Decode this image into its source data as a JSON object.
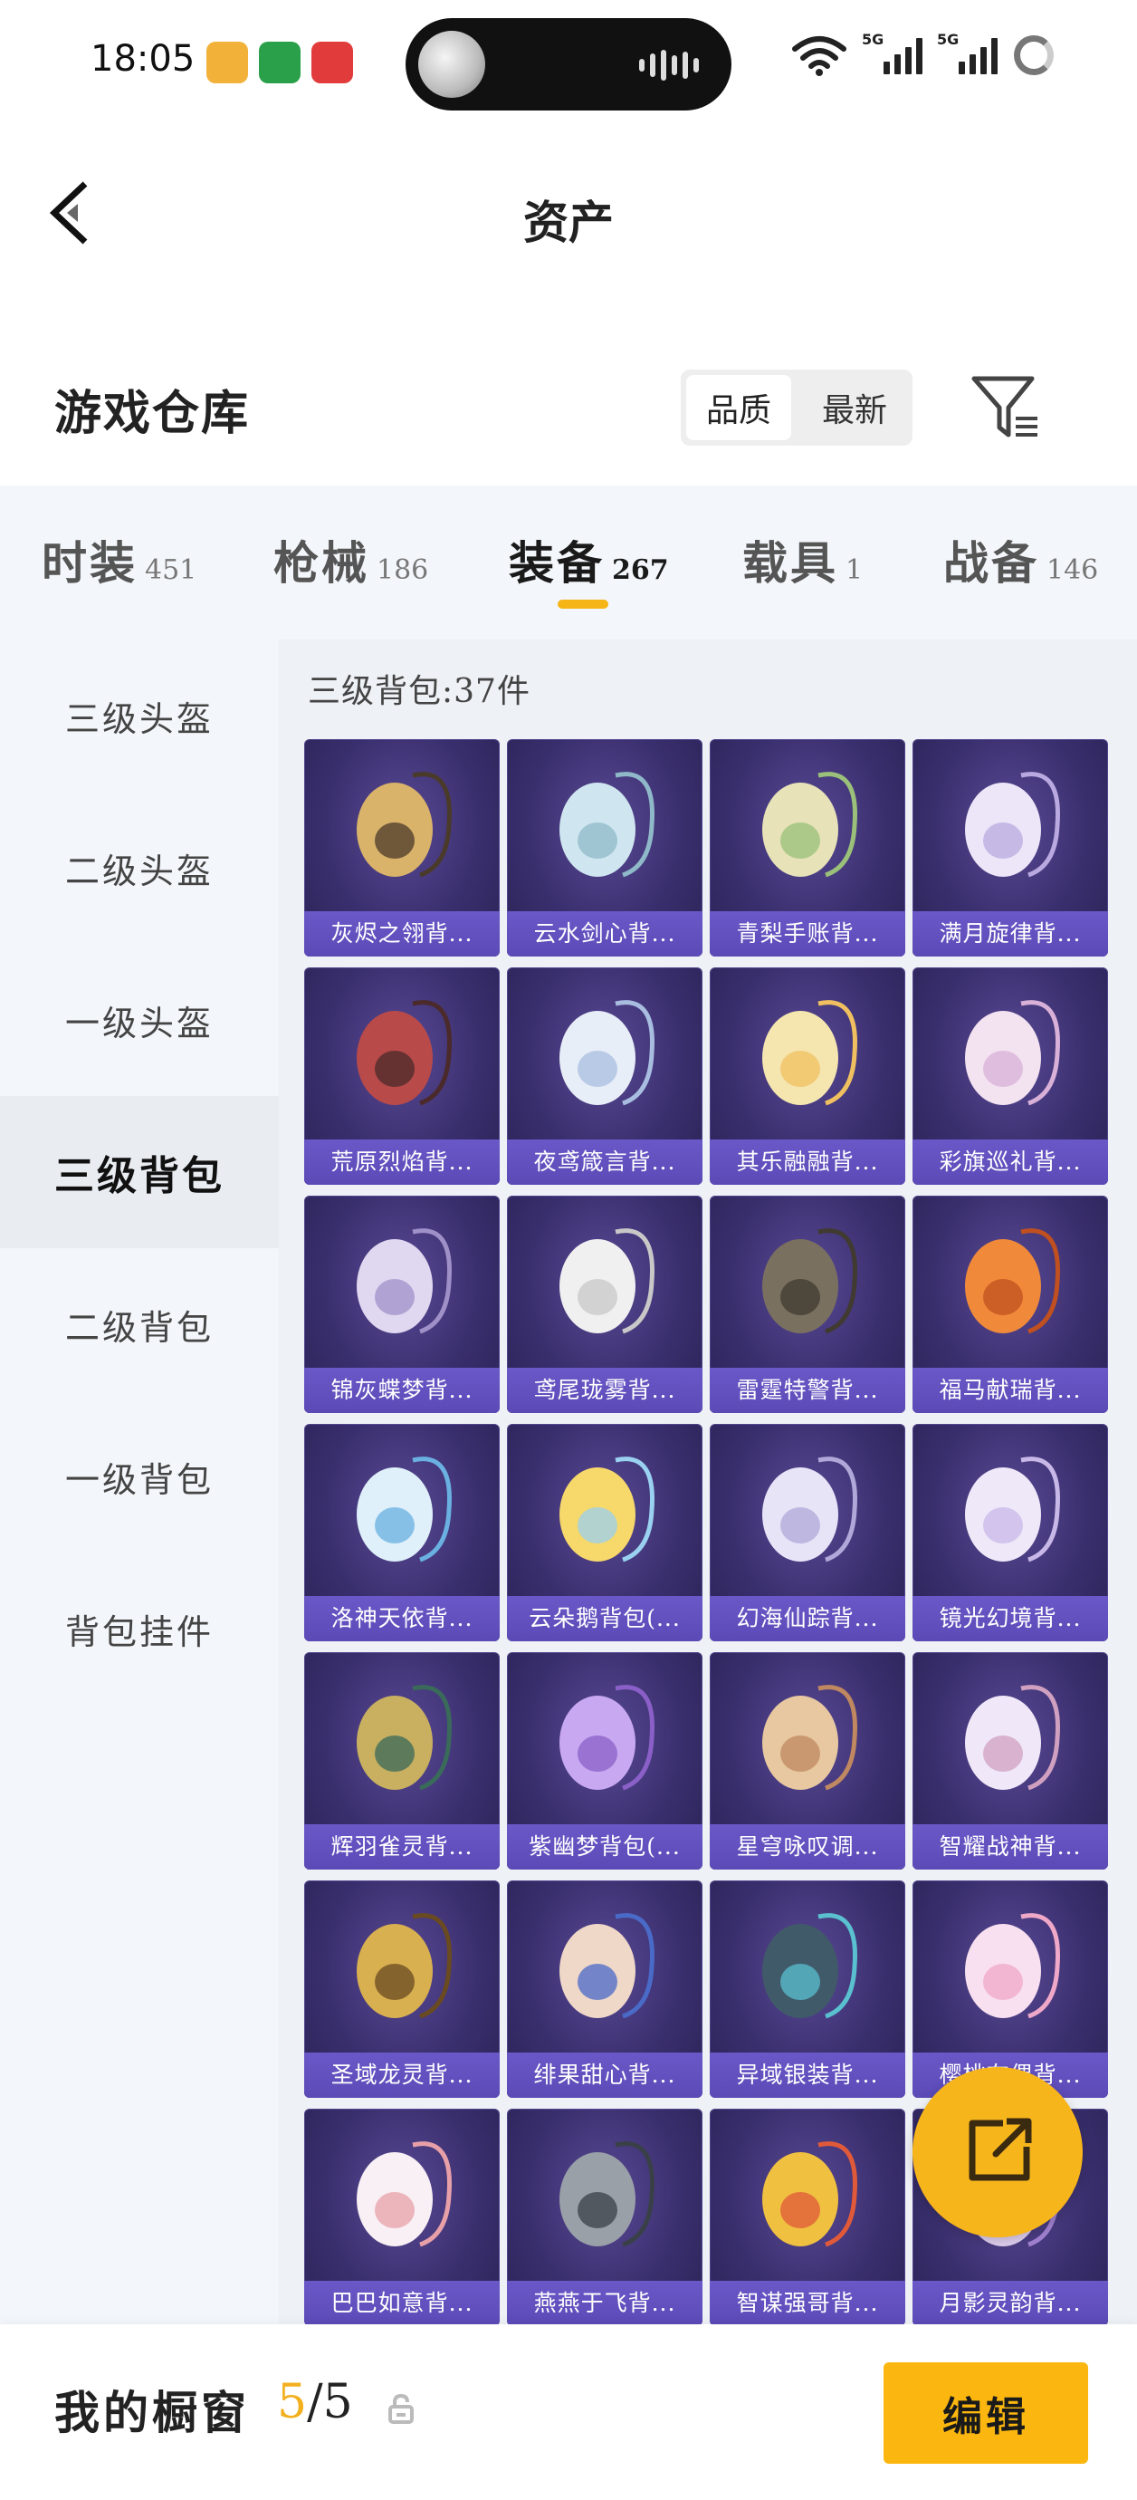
{
  "status_bar": {
    "time": "18:05",
    "network_1": "5G",
    "network_2": "5G"
  },
  "header": {
    "title": "资产",
    "back_icon": "back-arrow-icon"
  },
  "section": {
    "title": "游戏仓库",
    "sort_options": [
      "品质",
      "最新"
    ],
    "sort_selected": "品质",
    "filter_icon": "filter-icon"
  },
  "tabs": [
    {
      "name": "时装",
      "count": "451"
    },
    {
      "name": "枪械",
      "count": "186"
    },
    {
      "name": "装备",
      "count": "267",
      "active": true
    },
    {
      "name": "载具",
      "count": "1"
    },
    {
      "name": "战备",
      "count": "146"
    }
  ],
  "sidebar": {
    "items": [
      "三级头盔",
      "二级头盔",
      "一级头盔",
      "三级背包",
      "二级背包",
      "一级背包",
      "背包挂件"
    ],
    "active": "三级背包"
  },
  "content": {
    "count_label": "三级背包:37件",
    "items": [
      "灰烬之翎背...",
      "云水剑心背...",
      "青梨手账背...",
      "满月旋律背...",
      "荒原烈焰背...",
      "夜鸢箴言背...",
      "其乐融融背...",
      "彩旗巡礼背...",
      "锦灰蝶梦背...",
      "鸢尾珑雾背...",
      "雷霆特警背...",
      "福马献瑞背...",
      "洛神天依背...",
      "云朵鹅背包(...",
      "幻海仙踪背...",
      "镜光幻境背...",
      "辉羽雀灵背...",
      "紫幽梦背包(...",
      "星穹咏叹调...",
      "智耀战神背...",
      "圣域龙灵背...",
      "绯果甜心背...",
      "异域银装背...",
      "樱桃布偶背...",
      "巴巴如意背...",
      "燕燕于飞背...",
      "智谋强哥背...",
      "月影灵韵背..."
    ]
  },
  "fab": {
    "icon": "share-icon"
  },
  "bottom": {
    "label": "我的橱窗",
    "current": "5",
    "separator": "/",
    "total": "5",
    "lock_icon": "lock-icon",
    "edit_label": "编辑"
  }
}
